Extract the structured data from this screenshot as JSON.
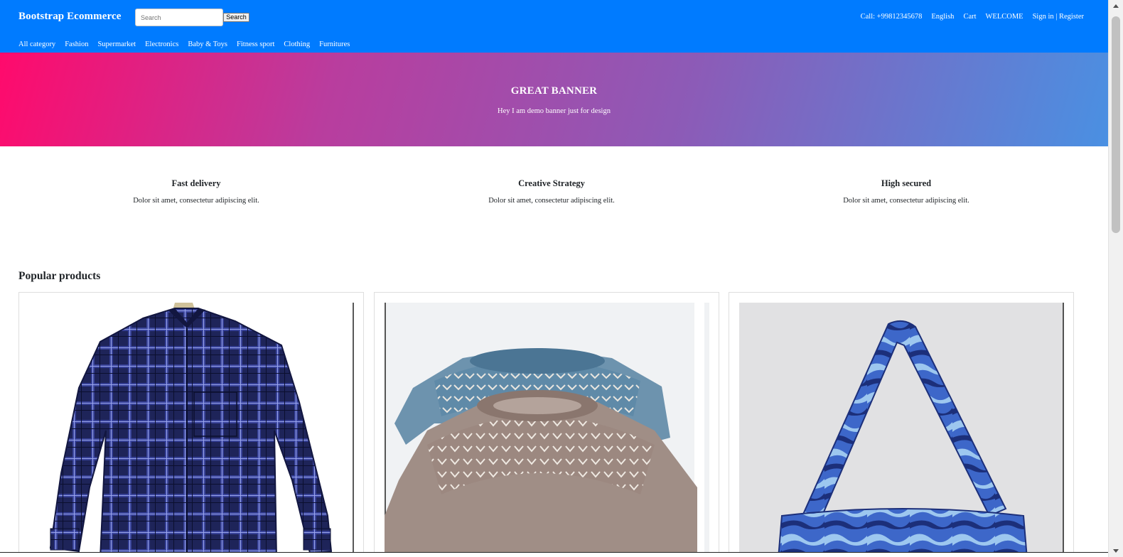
{
  "header": {
    "brand": "Bootstrap Ecommerce",
    "search": {
      "placeholder": "Search",
      "button_label": "Search"
    },
    "links": {
      "call": "Call: +99812345678",
      "language": "English",
      "cart": "Cart",
      "welcome": "WELCOME",
      "signin": "Sign in | Register"
    },
    "categories": [
      "All category",
      "Fashion",
      "Supermarket",
      "Electronics",
      "Baby & Toys",
      "Fitness sport",
      "Clothing",
      "Furnitures"
    ],
    "bg_color": "#007bff"
  },
  "banner": {
    "title": "GREAT BANNER",
    "subtitle": "Hey I am demo banner just for design",
    "gradient_start": "#ff0a6c",
    "gradient_end": "#4a90e2"
  },
  "features": [
    {
      "title": "Fast delivery",
      "text": "Dolor sit amet, consectetur adipiscing elit."
    },
    {
      "title": "Creative Strategy",
      "text": "Dolor sit amet, consectetur adipiscing elit."
    },
    {
      "title": "High secured",
      "text": "Dolor sit amet, consectetur adipiscing elit."
    }
  ],
  "popular": {
    "title": "Popular products",
    "products": [
      {
        "image": "plaid-shirt-image"
      },
      {
        "image": "knit-sweaters-image"
      },
      {
        "image": "blue-bag-image"
      }
    ]
  }
}
